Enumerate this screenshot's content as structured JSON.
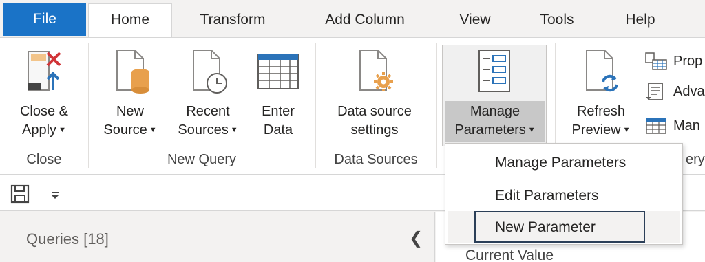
{
  "tabs": {
    "file": "File",
    "home": "Home",
    "transform": "Transform",
    "add_column": "Add Column",
    "view": "View",
    "tools": "Tools",
    "help": "Help"
  },
  "ribbon": {
    "close_apply": [
      "Close &",
      "Apply"
    ],
    "new_source": [
      "New",
      "Source"
    ],
    "recent_sources": [
      "Recent",
      "Sources"
    ],
    "enter_data": [
      "Enter",
      "Data"
    ],
    "data_source_settings": [
      "Data source",
      "settings"
    ],
    "manage_parameters": [
      "Manage",
      "Parameters"
    ],
    "refresh_preview": [
      "Refresh",
      "Preview"
    ],
    "properties": "Prop",
    "advanced_editor": "Adva",
    "manage": "Man",
    "groups": {
      "close": "Close",
      "new_query": "New Query",
      "data_sources": "Data Sources",
      "query_partial": "ery"
    }
  },
  "dropdown": {
    "items": [
      "Manage Parameters",
      "Edit Parameters",
      "New Parameter"
    ]
  },
  "queries": {
    "title": "Queries [18]"
  },
  "right_panel": {
    "current_value": "Current Value"
  },
  "colors": {
    "file_tab": "#1a73c7",
    "accent_orange": "#e8a04d",
    "icon_blue": "#2b73b9"
  }
}
